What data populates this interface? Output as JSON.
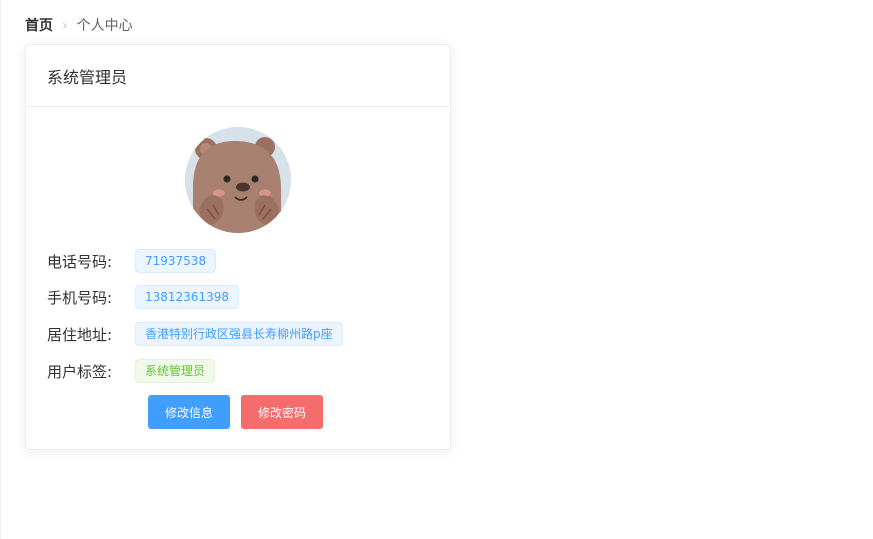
{
  "breadcrumb": {
    "home": "首页",
    "separator": ">",
    "current": "个人中心"
  },
  "profile_card": {
    "title": "系统管理员",
    "avatar_icon": "bear-avatar-icon",
    "rows": [
      {
        "label": "电话号码:",
        "value": "71937538",
        "tag_type": "primary"
      },
      {
        "label": "手机号码:",
        "value": "13812361398",
        "tag_type": "primary"
      },
      {
        "label": "居住地址:",
        "value": "香港特别行政区强县长寿柳州路p座",
        "tag_type": "primary"
      },
      {
        "label": "用户标签:",
        "value": "系统管理员",
        "tag_type": "success"
      }
    ],
    "buttons": {
      "edit_info": "修改信息",
      "change_password": "修改密码"
    }
  },
  "colors": {
    "primary": "#409eff",
    "danger": "#f56c6c",
    "success": "#67c23a"
  }
}
